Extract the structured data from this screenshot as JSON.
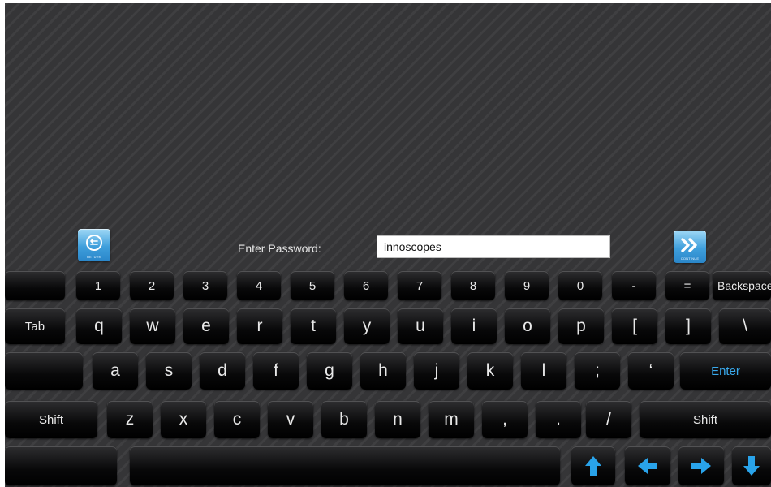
{
  "header": {
    "return_caption": "RETURN",
    "continue_caption": "CONTINUE",
    "password_label": "Enter Password:",
    "password_value": "innoscopes"
  },
  "keyboard": {
    "row1": [
      "",
      "1",
      "2",
      "3",
      "4",
      "5",
      "6",
      "7",
      "8",
      "9",
      "0",
      "-",
      "=",
      "Backspace"
    ],
    "row2": [
      "Tab",
      "q",
      "w",
      "e",
      "r",
      "t",
      "y",
      "u",
      "i",
      "o",
      "p",
      "[",
      "]",
      "\\"
    ],
    "row3": [
      "",
      "a",
      "s",
      "d",
      "f",
      "g",
      "h",
      "j",
      "k",
      "l",
      ";",
      "‘",
      "Enter"
    ],
    "row4": [
      "Shift",
      "z",
      "x",
      "c",
      "v",
      "b",
      "n",
      "m",
      ",",
      ".",
      "/",
      "Shift"
    ],
    "row5": [
      "",
      "",
      "arrow-up-icon",
      "arrow-left-icon",
      "arrow-right-icon",
      "arrow-down-icon"
    ]
  },
  "colors": {
    "background": "#38383a",
    "key_text": "#e9e9e9",
    "enter_text": "#39a9ec",
    "nav_button": "#3f9fdc",
    "arrow_icon": "#29a3ea"
  }
}
